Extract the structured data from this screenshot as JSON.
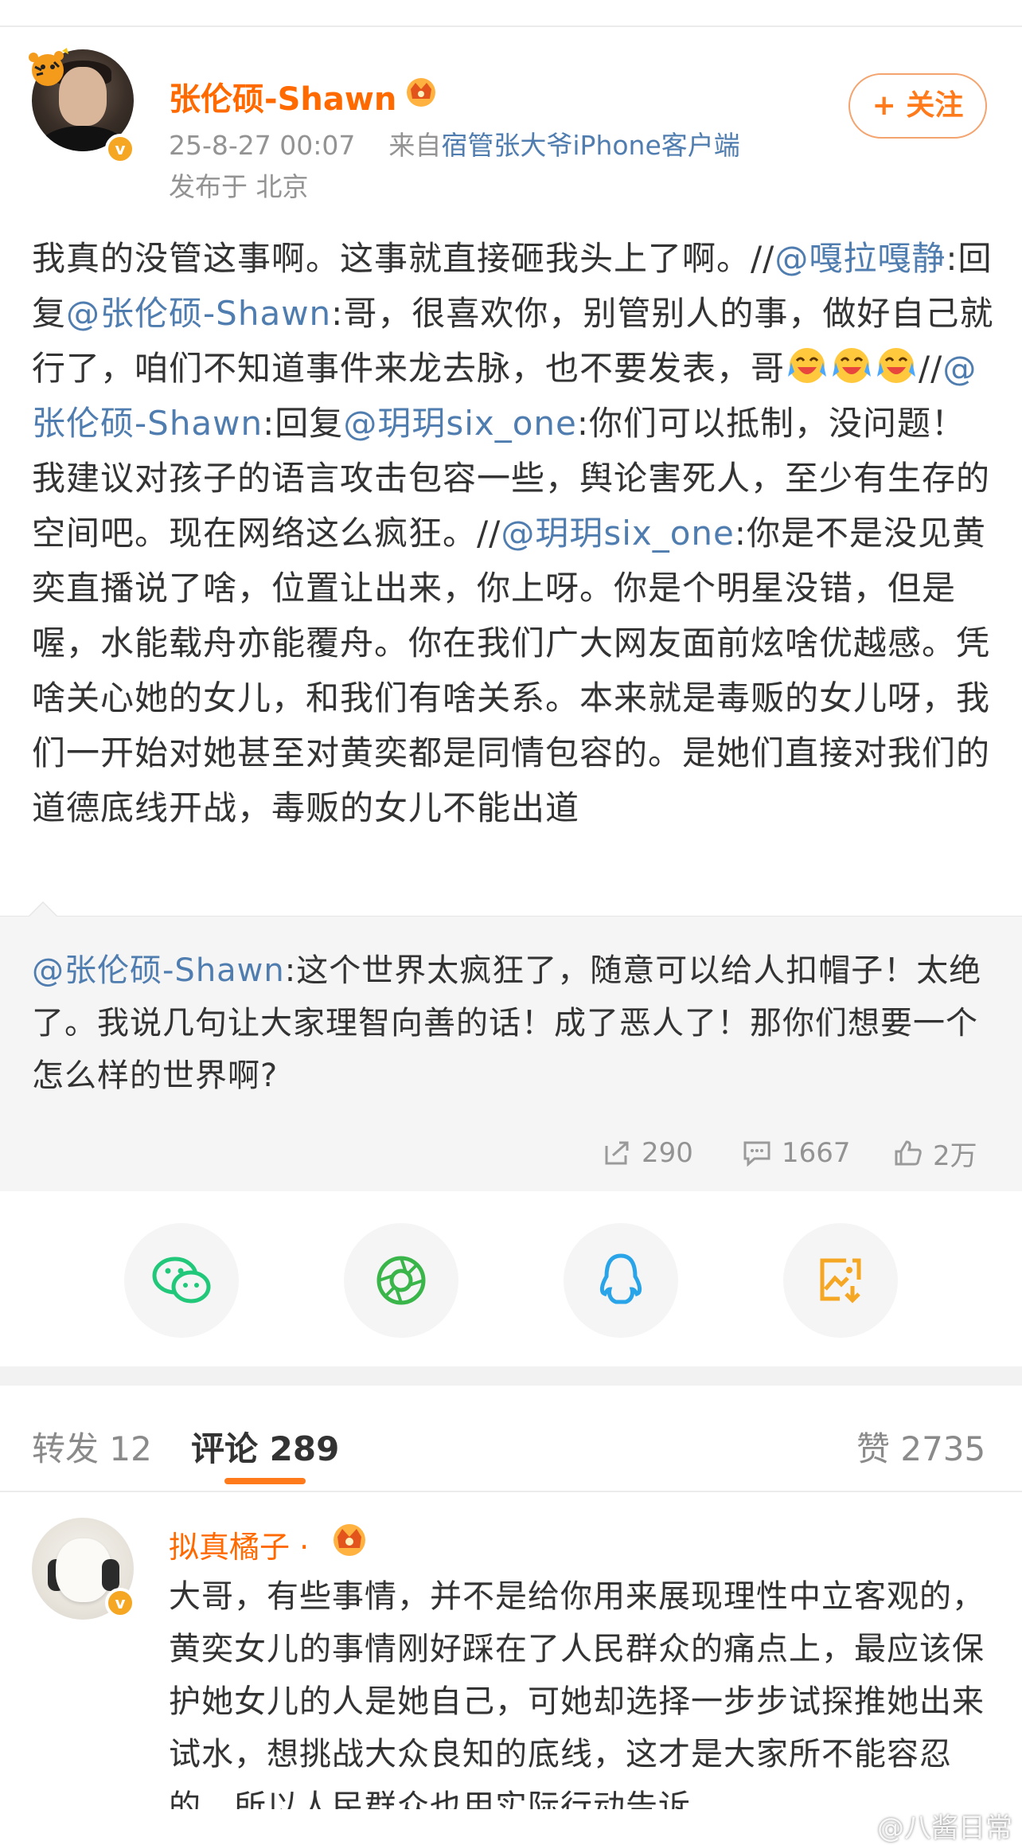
{
  "post": {
    "author": "张伦硕-Shawn",
    "time": "25-8-27 00:07",
    "source_prefix": "来自",
    "source": "宿管张大爷iPhone客户端",
    "location": "发布于 北京",
    "follow_label": "+ 关注",
    "body": {
      "seg1": "我真的没管这事啊。这事就直接砸我头上了啊。//",
      "m1": "@嘎拉嘎静",
      "seg2": ":回复",
      "m2": "@张伦硕-Shawn",
      "seg3": ":哥，很喜欢你，别管别人的事，做好自己就行了，咱们不知道事件来龙去脉，也不要发表，哥",
      "seg4": "//",
      "m3": "@张伦硕-Shawn",
      "seg5": ":回复",
      "m4": "@玥玥six_one",
      "seg6": ":你们可以抵制，没问题！我建议对孩子的语言攻击包容一些，舆论害死人，至少有生存的空间吧。现在网络这么疯狂。//",
      "m5": "@玥玥six_one",
      "seg7": ":你是不是没见黄奕直播说了啥，位置让出来，你上呀。你是个明星没错，但是喔，水能载舟亦能覆舟。你在我们广大网友面前炫啥优越感。凭啥关心她的女儿，和我们有啥关系。本来就是毒贩的女儿呀，我们一开始对她甚至对黄奕都是同情包容的。是她们直接对我们的道德底线开战，毒贩的女儿不能出道"
    },
    "emoji": [
      "crying-laugh",
      "crying-laugh",
      "crying-laugh"
    ]
  },
  "quote": {
    "mention": "@张伦硕-Shawn",
    "text": ":这个世界太疯狂了，随意可以给人扣帽子！太绝了。我说几句让大家理智向善的话！成了恶人了！那你们想要一个怎么样的世界啊?",
    "reposts": "290",
    "comments": "1667",
    "likes": "2万"
  },
  "share": {
    "items": [
      "wechat-icon",
      "moments-icon",
      "qq-icon",
      "save-image-icon"
    ],
    "colors": {
      "wechat": "#21c87a",
      "moments": "#3ab54a",
      "qq": "#2aa4e8",
      "save": "#f5a623"
    }
  },
  "tabs": {
    "repost_label": "转发 12",
    "comment_label": "评论 289",
    "like_label": "赞 2735"
  },
  "comment": {
    "author": "拟真橘子",
    "dot": "·",
    "text": "大哥，有些事情，并不是给你用来展现理性中立客观的，黄奕女儿的事情刚好踩在了人民群众的痛点上，最应该保护她女儿的人是她自己，可她却选择一步步试探推她出来试水，想挑战大众良知的底线，这才是大家所不能容忍的，所以人民群众也用实际行动告诉"
  },
  "watermark": "@八酱日常",
  "colors": {
    "accent": "#ff7a1a",
    "mention": "#507daf",
    "name": "#ff6a00"
  }
}
